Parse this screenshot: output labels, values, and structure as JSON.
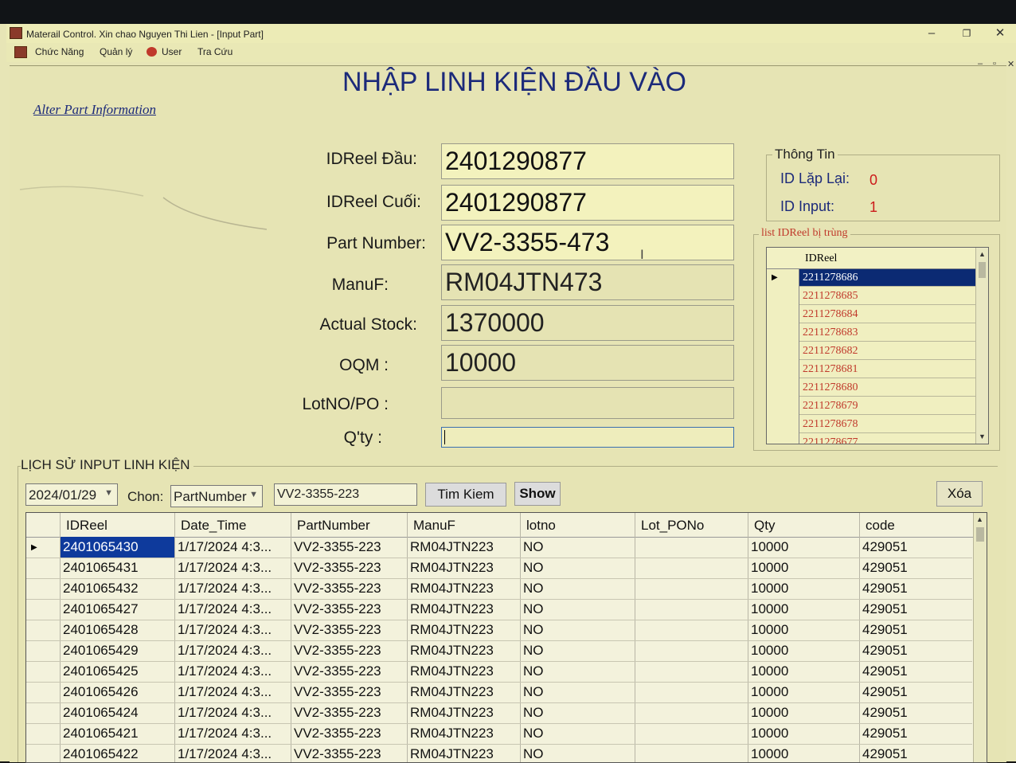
{
  "window": {
    "title": "Materail Control. Xin chao Nguyen Thi Lien - [Input Part]",
    "minimize": "–",
    "restore": "❐",
    "close": "✕"
  },
  "menu": {
    "items": [
      "Chức Năng",
      "Quản lý",
      "User",
      "Tra Cứu"
    ]
  },
  "mdi_controls": {
    "minimize": "–",
    "restore": "▫",
    "close": "✕"
  },
  "page": {
    "title": "NHẬP LINH KIỆN ĐẦU VÀO",
    "alter_link": "Alter Part Information"
  },
  "form": {
    "idreel_dau": {
      "label": "IDReel Đầu:",
      "value": "2401290877"
    },
    "idreel_cuoi": {
      "label": "IDReel Cuối:",
      "value": "2401290877"
    },
    "part_number": {
      "label": "Part Number:",
      "value": "VV2-3355-473"
    },
    "manuf": {
      "label": "ManuF:",
      "value": "RM04JTN473"
    },
    "actual_stock": {
      "label": "Actual Stock:",
      "value": "1370000"
    },
    "oqm": {
      "label": "OQM :",
      "value": "10000"
    },
    "lot_po": {
      "label": "LotNO/PO :",
      "value": ""
    },
    "qty": {
      "label": "Q'ty :",
      "value": ""
    }
  },
  "info": {
    "group_label": "Thông Tin",
    "id_lap_lai_label": "ID Lặp Lại:",
    "id_lap_lai_value": "0",
    "id_input_label": "ID Input:",
    "id_input_value": "1"
  },
  "dup_list": {
    "group_label": "list IDReel bị trùng",
    "header": "IDReel",
    "rows": [
      "2211278686",
      "2211278685",
      "2211278684",
      "2211278683",
      "2211278682",
      "2211278681",
      "2211278680",
      "2211278679",
      "2211278678",
      "2211278677"
    ]
  },
  "history": {
    "label": "LỊCH SỬ INPUT LINH KIỆN",
    "date": "2024/01/29",
    "chon_label": "Chon:",
    "chon_value": "PartNumber",
    "search_value": "VV2-3355-223",
    "search_button": "Tim Kiem",
    "show_button": "Show",
    "delete_button": "Xóa",
    "columns": [
      "IDReel",
      "Date_Time",
      "PartNumber",
      "ManuF",
      "lotno",
      "Lot_PONo",
      "Qty",
      "code"
    ],
    "rows": [
      [
        "2401065430",
        "1/17/2024 4:3...",
        "VV2-3355-223",
        "RM04JTN223",
        "NO",
        "",
        "10000",
        "429051"
      ],
      [
        "2401065431",
        "1/17/2024 4:3...",
        "VV2-3355-223",
        "RM04JTN223",
        "NO",
        "",
        "10000",
        "429051"
      ],
      [
        "2401065432",
        "1/17/2024 4:3...",
        "VV2-3355-223",
        "RM04JTN223",
        "NO",
        "",
        "10000",
        "429051"
      ],
      [
        "2401065427",
        "1/17/2024 4:3...",
        "VV2-3355-223",
        "RM04JTN223",
        "NO",
        "",
        "10000",
        "429051"
      ],
      [
        "2401065428",
        "1/17/2024 4:3...",
        "VV2-3355-223",
        "RM04JTN223",
        "NO",
        "",
        "10000",
        "429051"
      ],
      [
        "2401065429",
        "1/17/2024 4:3...",
        "VV2-3355-223",
        "RM04JTN223",
        "NO",
        "",
        "10000",
        "429051"
      ],
      [
        "2401065425",
        "1/17/2024 4:3...",
        "VV2-3355-223",
        "RM04JTN223",
        "NO",
        "",
        "10000",
        "429051"
      ],
      [
        "2401065426",
        "1/17/2024 4:3...",
        "VV2-3355-223",
        "RM04JTN223",
        "NO",
        "",
        "10000",
        "429051"
      ],
      [
        "2401065424",
        "1/17/2024 4:3...",
        "VV2-3355-223",
        "RM04JTN223",
        "NO",
        "",
        "10000",
        "429051"
      ],
      [
        "2401065421",
        "1/17/2024 4:3...",
        "VV2-3355-223",
        "RM04JTN223",
        "NO",
        "",
        "10000",
        "429051"
      ],
      [
        "2401065422",
        "1/17/2024 4:3...",
        "VV2-3355-223",
        "RM04JTN223",
        "NO",
        "",
        "10000",
        "429051"
      ]
    ]
  }
}
